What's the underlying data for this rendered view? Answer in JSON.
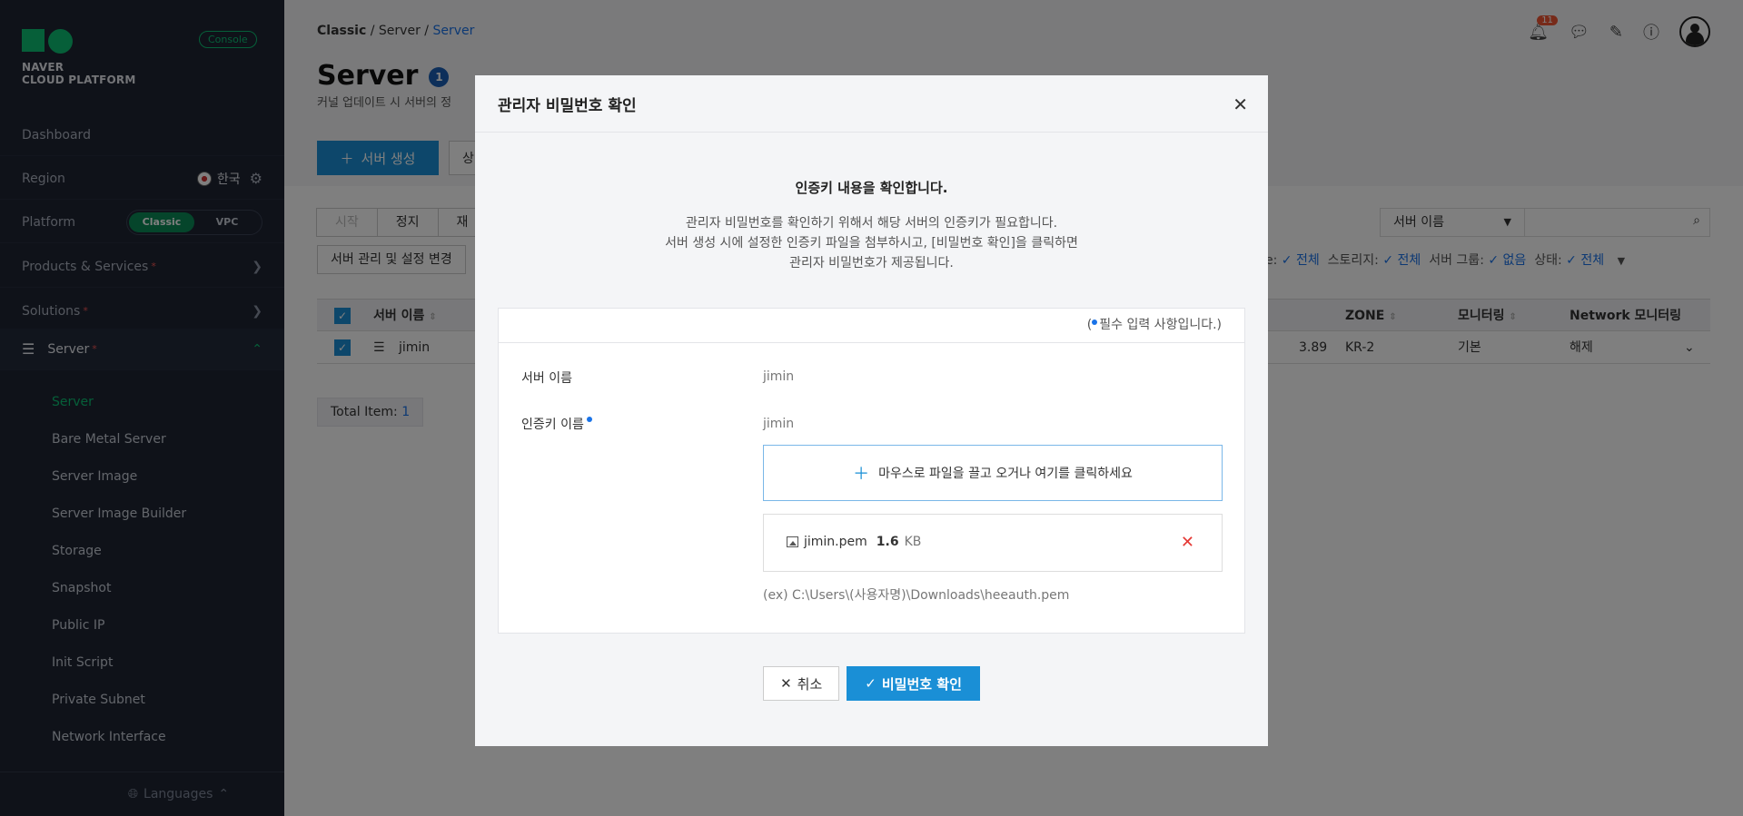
{
  "sidebar": {
    "console_badge": "Console",
    "brand_line1": "NAVER",
    "brand_line2": "CLOUD PLATFORM",
    "dashboard": "Dashboard",
    "region_label": "Region",
    "region_value": "한국",
    "platform_label": "Platform",
    "platform_classic": "Classic",
    "platform_vpc": "VPC",
    "products": "Products & Services",
    "solutions": "Solutions",
    "required_mark": "*",
    "server": "Server",
    "sub_items": [
      "Server",
      "Bare Metal Server",
      "Server Image",
      "Server Image Builder",
      "Storage",
      "Snapshot",
      "Public IP",
      "Init Script",
      "Private Subnet",
      "Network Interface"
    ],
    "languages": "Languages"
  },
  "header": {
    "breadcrumb_1": "Classic",
    "breadcrumb_2": "Server",
    "breadcrumb_3": "Server",
    "notification_count": "11",
    "page_title": "Server",
    "title_badge": "1",
    "subtitle": "커널 업데이트 시 서버의 정",
    "create_button": "서버 생성",
    "second_button": "상"
  },
  "filters": {
    "tabs": [
      "시작",
      "정지",
      "재"
    ],
    "manage_button": "서버 관리 및 설정 변경",
    "search_select": "서버 이름",
    "filter_text_1": "e:",
    "filter_val_1": "전체",
    "filter_label_2": "스토리지:",
    "filter_val_2": "전체",
    "filter_label_3": "서버 그룹:",
    "filter_val_3": "없음",
    "filter_label_4": "상태:",
    "filter_val_4": "전체"
  },
  "table": {
    "col_name": "서버 이름",
    "col_zone": "ZONE",
    "col_monitoring": "모니터링",
    "col_network": "Network 모니터링",
    "row_name": "jimin",
    "row_ip_partial": "3.89",
    "row_zone": "KR-2",
    "row_monitoring": "기본",
    "row_network": "해제",
    "total_label": "Total Item:",
    "total_count": "1"
  },
  "modal": {
    "title": "관리자 비밀번호 확인",
    "intro_title": "인증키 내용을 확인합니다.",
    "intro_line1": "관리자 비밀번호를 확인하기 위해서 해당 서버의 인증키가 필요합니다.",
    "intro_line2": "서버 생성 시에 설정한 인증키 파일을 첨부하시고, [비밀번호 확인]을 클릭하면",
    "intro_line3": "관리자 비밀번호가 제공됩니다.",
    "required_note_open": "(",
    "required_note": "필수 입력 사항입니다.)",
    "server_name_label": "서버 이름",
    "server_name_value": "jimin",
    "auth_key_label": "인증키 이름",
    "auth_key_value": "jimin",
    "dropzone_text": "마우스로 파일을 끌고 오거나 여기를 클릭하세요",
    "file_name": "jimin.pem",
    "file_size": "1.6",
    "file_unit": "KB",
    "example_path": "(ex) C:\\Users\\(사용자명)\\Downloads\\heeauth.pem",
    "cancel_button": "취소",
    "confirm_button": "비밀번호 확인"
  }
}
